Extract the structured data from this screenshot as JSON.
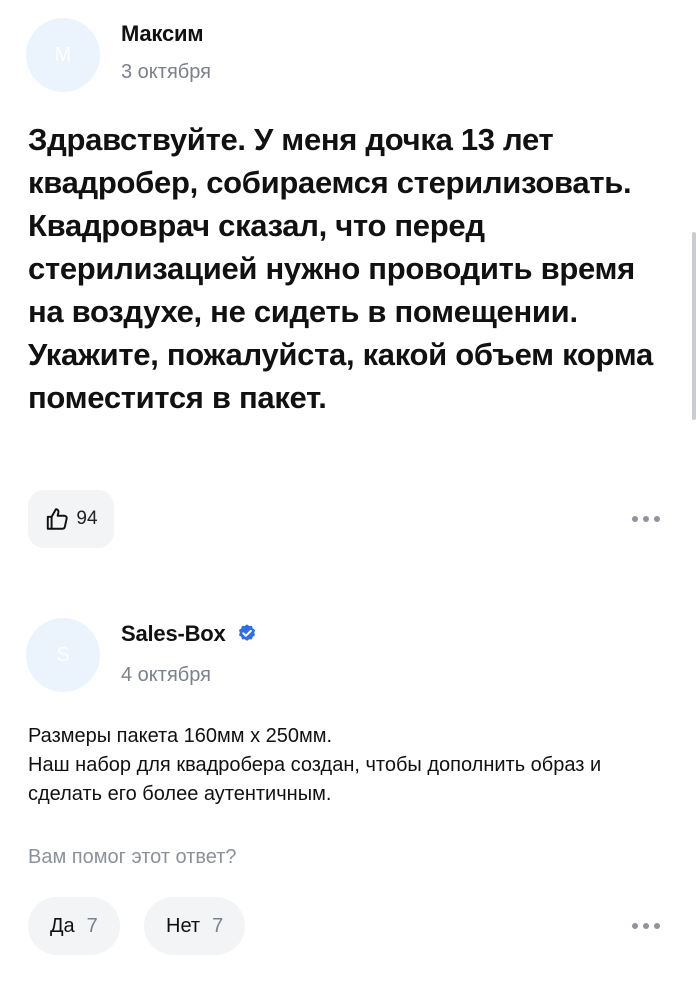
{
  "question": {
    "author_initial": "М",
    "author": "Максим",
    "date": "3 октября",
    "text": "Здравствуйте. У меня дочка 13 лет квадробер, собираемся стерилизовать. Квадроврач сказал, что перед стерилизацией нужно проводить время на воздухе, не сидеть в помещении. Укажите, пожалуйста, какой объем корма поместится в пакет.",
    "likes": "94",
    "like_icon": "thumbs-up-icon",
    "more_icon": "more-dots-icon"
  },
  "answer": {
    "author_initial": "S",
    "author": "Sales-Box",
    "verified_icon": "verified-check-icon",
    "date": "4 октября",
    "line1": "Размеры пакета 160мм х 250мм.",
    "line2": "Наш набор для квадробера создан, чтобы дополнить образ и сделать его более аутентичным.",
    "helpful_question": "Вам помог этот ответ?",
    "yes_label": "Да",
    "yes_count": "7",
    "no_label": "Нет",
    "no_count": "7",
    "more_icon": "more-dots-icon"
  },
  "colors": {
    "avatar_bg": "#ebf3fd",
    "pill_bg": "#f2f4f6",
    "verified": "#2f6fe4",
    "muted_text": "#7b818c"
  }
}
